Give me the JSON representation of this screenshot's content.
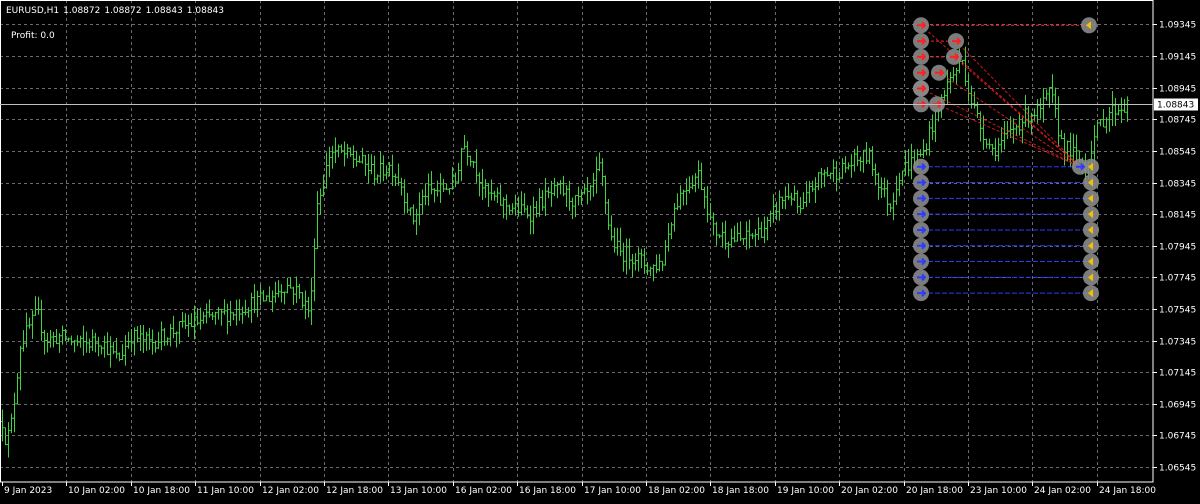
{
  "header": {
    "symbol": "EURUSD,H1",
    "open": "1.08872",
    "high": "1.08872",
    "low": "1.08843",
    "close": "1.08843"
  },
  "profit_text": "Profit: 0.0",
  "colors": {
    "background": "#000000",
    "grid": "#6b6b6b",
    "bars": "#3fd23f",
    "axis_text": "#ffffff",
    "price_line": "#c0c0c0",
    "sell_order": "#ff2020",
    "buy_order": "#2a3cff",
    "marker_ring": "#8a8a8a"
  },
  "chart_data": {
    "type": "ohlc",
    "symbol": "EURUSD",
    "timeframe": "H1",
    "ylim": [
      1.0645,
      1.095
    ],
    "grid": true,
    "current_price": "1.08843",
    "y_ticks": [
      "1.09345",
      "1.09145",
      "1.08945",
      "1.08745",
      "1.08545",
      "1.08345",
      "1.08145",
      "1.07945",
      "1.07745",
      "1.07545",
      "1.07345",
      "1.07145",
      "1.06945",
      "1.06745",
      "1.06545"
    ],
    "x_ticks": [
      "9 Jan 2023",
      "10 Jan 02:00",
      "10 Jan 18:00",
      "11 Jan 10:00",
      "12 Jan 02:00",
      "12 Jan 18:00",
      "13 Jan 10:00",
      "16 Jan 02:00",
      "16 Jan 18:00",
      "17 Jan 10:00",
      "18 Jan 02:00",
      "18 Jan 18:00",
      "19 Jan 10:00",
      "20 Jan 02:00",
      "20 Jan 18:00",
      "23 Jan 10:00",
      "24 Jan 02:00",
      "24 Jan 18:00"
    ],
    "price_path": [
      [
        0,
        1.069
      ],
      [
        6,
        1.067
      ],
      [
        12,
        1.0685
      ],
      [
        20,
        1.0732
      ],
      [
        28,
        1.0742
      ],
      [
        37,
        1.0752
      ],
      [
        45,
        1.0735
      ],
      [
        60,
        1.0737
      ],
      [
        80,
        1.0732
      ],
      [
        100,
        1.0735
      ],
      [
        118,
        1.0722
      ],
      [
        130,
        1.0738
      ],
      [
        150,
        1.0733
      ],
      [
        170,
        1.074
      ],
      [
        190,
        1.0745
      ],
      [
        210,
        1.0749
      ],
      [
        230,
        1.0752
      ],
      [
        250,
        1.0758
      ],
      [
        270,
        1.0762
      ],
      [
        285,
        1.077
      ],
      [
        298,
        1.0765
      ],
      [
        310,
        1.0752
      ],
      [
        316,
        1.082
      ],
      [
        322,
        1.0832
      ],
      [
        330,
        1.0855
      ],
      [
        345,
        1.0852
      ],
      [
        360,
        1.0848
      ],
      [
        375,
        1.084
      ],
      [
        390,
        1.0845
      ],
      [
        400,
        1.0835
      ],
      [
        412,
        1.081
      ],
      [
        425,
        1.0828
      ],
      [
        440,
        1.083
      ],
      [
        455,
        1.0835
      ],
      [
        462,
        1.086
      ],
      [
        472,
        1.085
      ],
      [
        485,
        1.0828
      ],
      [
        500,
        1.0822
      ],
      [
        515,
        1.0818
      ],
      [
        530,
        1.0815
      ],
      [
        545,
        1.0825
      ],
      [
        560,
        1.083
      ],
      [
        575,
        1.0822
      ],
      [
        590,
        1.0828
      ],
      [
        600,
        1.0845
      ],
      [
        610,
        1.08
      ],
      [
        620,
        1.079
      ],
      [
        635,
        1.0788
      ],
      [
        650,
        1.078
      ],
      [
        662,
        1.0785
      ],
      [
        672,
        1.0815
      ],
      [
        682,
        1.083
      ],
      [
        690,
        1.0835
      ],
      [
        698,
        1.084
      ],
      [
        705,
        1.0825
      ],
      [
        712,
        1.0805
      ],
      [
        725,
        1.08
      ],
      [
        740,
        1.0798
      ],
      [
        755,
        1.0802
      ],
      [
        768,
        1.0808
      ],
      [
        778,
        1.0822
      ],
      [
        790,
        1.0828
      ],
      [
        800,
        1.0815
      ],
      [
        810,
        1.083
      ],
      [
        822,
        1.084
      ],
      [
        840,
        1.0842
      ],
      [
        855,
        1.0848
      ],
      [
        868,
        1.0852
      ],
      [
        880,
        1.0832
      ],
      [
        890,
        1.082
      ],
      [
        900,
        1.0842
      ],
      [
        912,
        1.0848
      ],
      [
        922,
        1.0852
      ],
      [
        930,
        1.0868
      ],
      [
        938,
        1.088
      ],
      [
        945,
        1.0895
      ],
      [
        955,
        1.0905
      ],
      [
        962,
        1.0912
      ],
      [
        970,
        1.0888
      ],
      [
        980,
        1.087
      ],
      [
        992,
        1.0855
      ],
      [
        1002,
        1.086
      ],
      [
        1015,
        1.087
      ],
      [
        1028,
        1.0878
      ],
      [
        1040,
        1.088
      ],
      [
        1050,
        1.0892
      ],
      [
        1060,
        1.0862
      ],
      [
        1068,
        1.0855
      ],
      [
        1078,
        1.085
      ],
      [
        1085,
        1.0842
      ],
      [
        1092,
        1.086
      ],
      [
        1100,
        1.0872
      ],
      [
        1110,
        1.088
      ],
      [
        1120,
        1.0882
      ],
      [
        1127,
        1.0883
      ]
    ],
    "sell_orders": [
      1.0934,
      1.0924,
      1.0914,
      1.0904,
      1.0894,
      1.0884
    ],
    "buy_orders": [
      1.08445,
      1.08345,
      1.08245,
      1.08145,
      1.08045,
      1.07945,
      1.07845,
      1.07745,
      1.07645
    ],
    "x_labels_position": "bottom",
    "y_labels_position": "right"
  }
}
